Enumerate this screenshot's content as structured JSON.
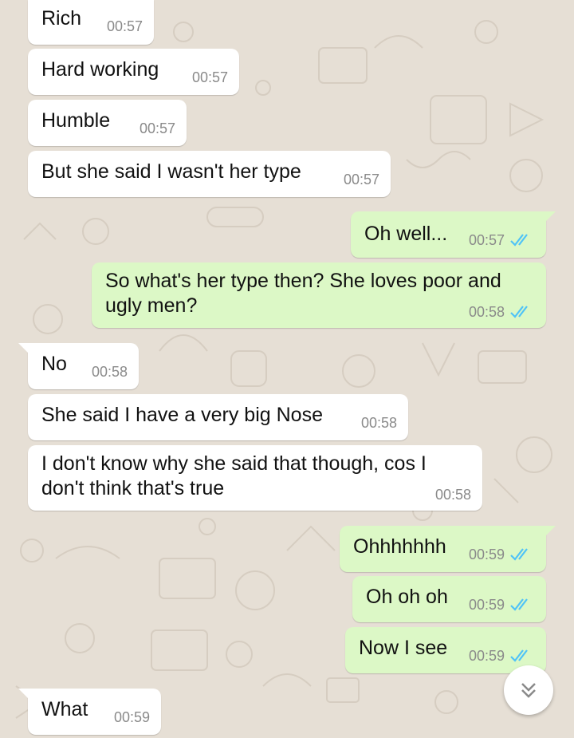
{
  "chat": {
    "wallpaper_color": "#e6dfd5",
    "incoming_bubble_color": "#ffffff",
    "outgoing_bubble_color": "#dcf8c6",
    "tick_color": "#4fc3f7",
    "messages": [
      {
        "direction": "in",
        "text": "Rich",
        "time": "00:57"
      },
      {
        "direction": "in",
        "text": "Hard working",
        "time": "00:57"
      },
      {
        "direction": "in",
        "text": "Humble",
        "time": "00:57"
      },
      {
        "direction": "in",
        "text": "But she said I wasn't her type",
        "time": "00:57"
      },
      {
        "direction": "out",
        "text": "Oh well...",
        "time": "00:57",
        "status": "read-double-tick"
      },
      {
        "direction": "out",
        "text_line1": "So what's her type then? She loves poor and",
        "text_line2": "ugly men?",
        "time": "00:58",
        "status": "read-double-tick"
      },
      {
        "direction": "in",
        "text": "No",
        "time": "00:58"
      },
      {
        "direction": "in",
        "text": "She said I have a very big Nose",
        "time": "00:58"
      },
      {
        "direction": "in",
        "text_line1": "I don't know why she said that though, cos I",
        "text_line2": "don't think that's true",
        "time": "00:58"
      },
      {
        "direction": "out",
        "text": "Ohhhhhhh",
        "time": "00:59",
        "status": "read-double-tick"
      },
      {
        "direction": "out",
        "text": "Oh oh oh",
        "time": "00:59",
        "status": "read-double-tick"
      },
      {
        "direction": "out",
        "text": "Now I see",
        "time": "00:59",
        "status": "read-double-tick"
      },
      {
        "direction": "in",
        "text": "What",
        "time": "00:59"
      }
    ],
    "scroll_button_icon": "double-chevron-down-icon"
  }
}
